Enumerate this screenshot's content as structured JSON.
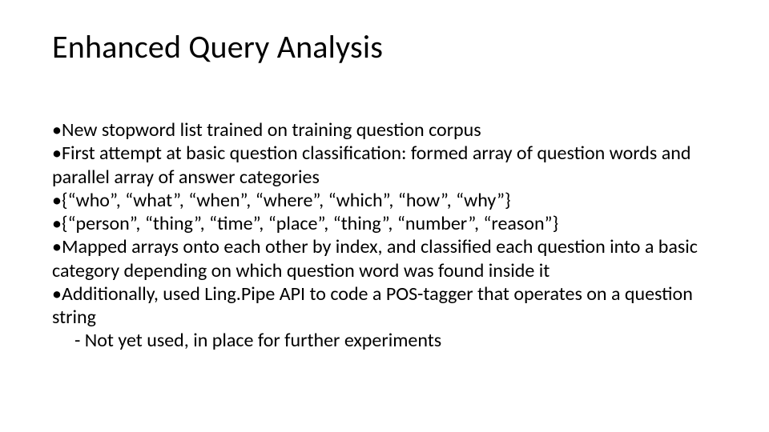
{
  "title": "Enhanced Query Analysis",
  "bullets": {
    "b1": "New stopword list trained on training question corpus",
    "b2": "First attempt at basic question classification: formed array of question words and parallel array of answer categories",
    "b3": "{“who”, “what”, “when”, “where”, “which”, “how”, “why”}",
    "b4": "{“person”, “thing”, “time”, “place”, “thing”, “number”, “reason”}",
    "b5": "Mapped arrays onto each other by index, and classified each question into a basic category depending on which question word was found inside it",
    "b6": "Additionally, used Ling.Pipe API to code a POS-tagger that operates on a question string",
    "sub1": "- Not yet used, in place for further experiments"
  },
  "dot": "•"
}
